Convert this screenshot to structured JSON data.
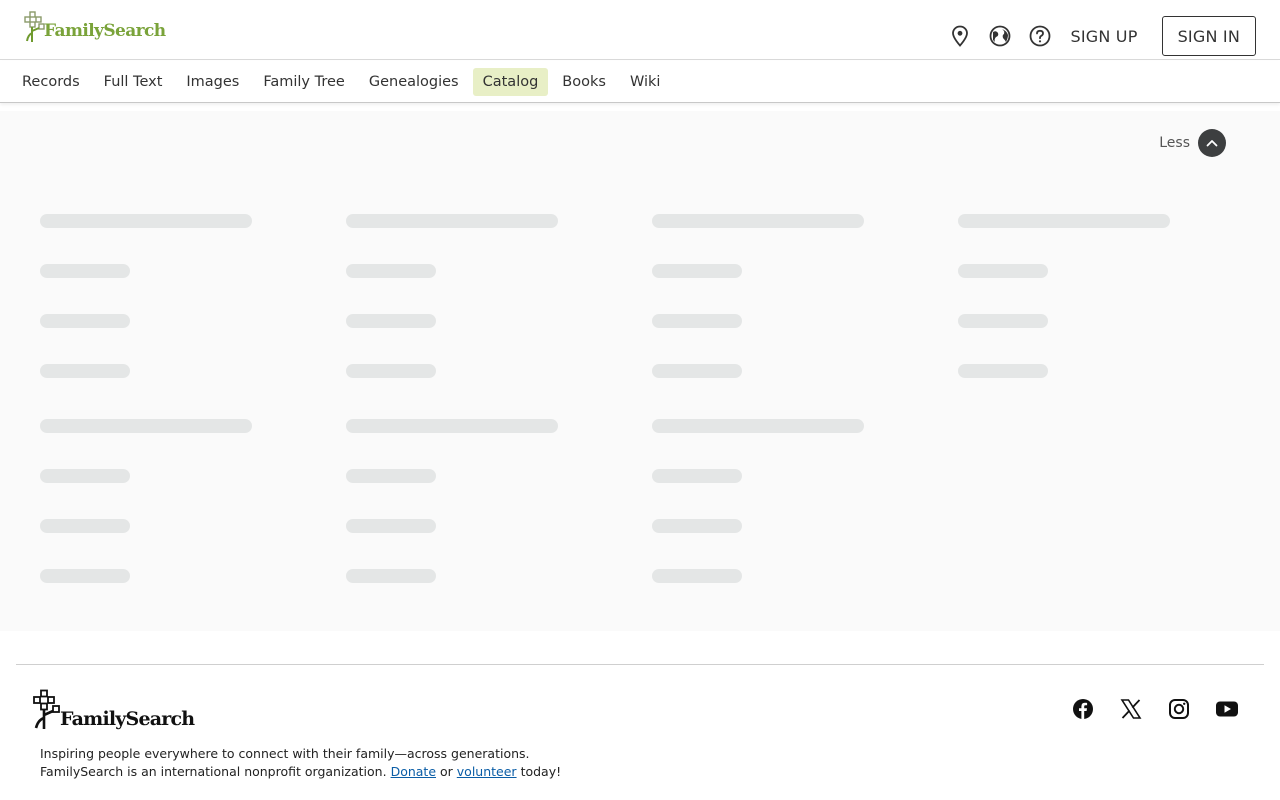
{
  "brand": {
    "name": "FamilySearch",
    "accent": "#7aa33a"
  },
  "header": {
    "icons": [
      "location-icon",
      "globe-icon",
      "help-icon"
    ],
    "sign_up": "SIGN UP",
    "sign_in": "SIGN IN"
  },
  "nav": {
    "items": [
      {
        "label": "Records",
        "active": false
      },
      {
        "label": "Full Text",
        "active": false
      },
      {
        "label": "Images",
        "active": false
      },
      {
        "label": "Family Tree",
        "active": false
      },
      {
        "label": "Genealogies",
        "active": false
      },
      {
        "label": "Catalog",
        "active": true
      },
      {
        "label": "Books",
        "active": false
      },
      {
        "label": "Wiki",
        "active": false
      }
    ],
    "active_color": "#e8efc6"
  },
  "main": {
    "less_label": "Less",
    "loading_state": "skeleton placeholders"
  },
  "footer": {
    "brand": "FamilySearch",
    "tagline": "Inspiring people everywhere to connect with their family—across generations.",
    "line2_prefix": "FamilySearch is an international nonprofit organization.",
    "donate": "Donate",
    "or": "or",
    "volunteer": "volunteer",
    "today": "today!",
    "social_icons": [
      "facebook-icon",
      "x-icon",
      "instagram-icon",
      "youtube-icon"
    ]
  }
}
